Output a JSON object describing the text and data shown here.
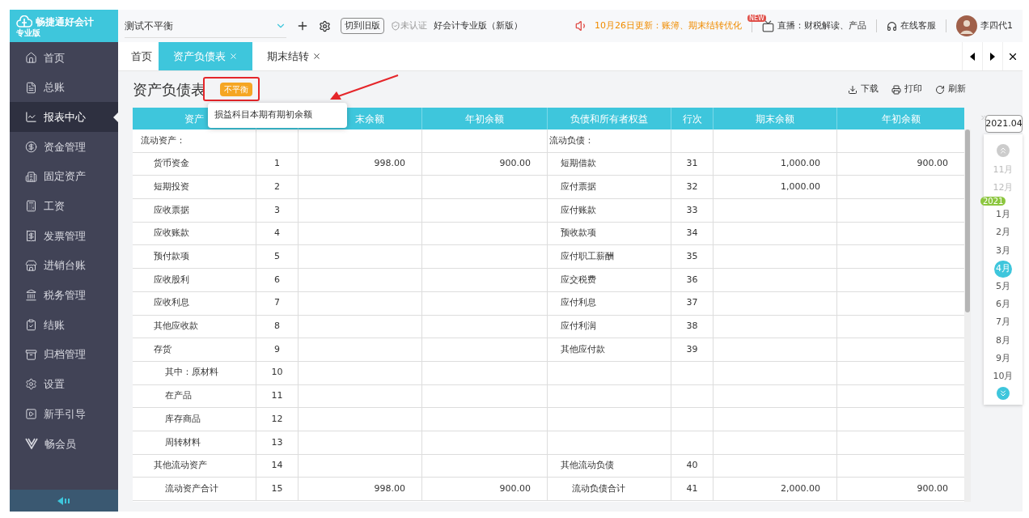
{
  "sidebar": {
    "logo": {
      "name": "畅捷通好会计",
      "edition": "专业版"
    },
    "items": [
      {
        "label": "首页",
        "selected": false
      },
      {
        "label": "总账",
        "selected": false
      },
      {
        "label": "报表中心",
        "selected": true
      },
      {
        "label": "资金管理",
        "selected": false
      },
      {
        "label": "固定资产",
        "selected": false
      },
      {
        "label": "工资",
        "selected": false
      },
      {
        "label": "发票管理",
        "selected": false
      },
      {
        "label": "进销台账",
        "selected": false
      },
      {
        "label": "税务管理",
        "selected": false
      },
      {
        "label": "结账",
        "selected": false
      },
      {
        "label": "归档管理",
        "selected": false
      },
      {
        "label": "设置",
        "selected": false
      },
      {
        "label": "新手引导",
        "selected": false
      },
      {
        "label": "畅会员",
        "selected": false
      }
    ]
  },
  "top_bar": {
    "account": "测试不平衡",
    "old_version_button": "切到旧版",
    "verify_status": "未认证",
    "product": "好会计专业版（新版）",
    "announcement": "10月26日更新：账簿、期末结转优化",
    "live_badge": "NEW",
    "live": "直播：财税解读、产品",
    "service": "在线客服",
    "user": "李四代1"
  },
  "tabs": [
    {
      "label": "首页",
      "closable": false,
      "selected": false
    },
    {
      "label": "资产负债表",
      "closable": true,
      "selected": true
    },
    {
      "label": "期末结转",
      "closable": true,
      "selected": false
    }
  ],
  "report": {
    "title": "资产负债表",
    "status": "不平衡",
    "tooltip": "损益科目本期有期初余额",
    "actions": [
      "下载",
      "打印",
      "刷新"
    ],
    "columns": [
      {
        "label": "资产"
      },
      {},
      {
        "label": "末余额"
      },
      {
        "label": "年初余额"
      },
      {
        "label": "负债和所有者权益"
      },
      {
        "label": "行次"
      },
      {
        "label": "期末余额"
      },
      {
        "label": "年初余额"
      }
    ],
    "rows": [
      {
        "kind": "section",
        "left": {
          "name": "流动资产："
        },
        "right": {
          "name": "流动负债："
        }
      },
      {
        "kind": "item",
        "left": {
          "name": "货币资金",
          "line": "1",
          "end": "998.00",
          "begin": "900.00"
        },
        "right": {
          "name": "短期借款",
          "line": "31",
          "end": "1,000.00",
          "begin": "900.00"
        }
      },
      {
        "kind": "item",
        "left": {
          "name": "短期投资",
          "line": "2"
        },
        "right": {
          "name": "应付票据",
          "line": "32",
          "end": "1,000.00"
        }
      },
      {
        "kind": "item",
        "left": {
          "name": "应收票据",
          "line": "3"
        },
        "right": {
          "name": "应付账款",
          "line": "33"
        }
      },
      {
        "kind": "item",
        "left": {
          "name": "应收账款",
          "line": "4"
        },
        "right": {
          "name": "预收款项",
          "line": "34"
        }
      },
      {
        "kind": "item",
        "left": {
          "name": "预付款项",
          "line": "5"
        },
        "right": {
          "name": "应付职工薪酬",
          "line": "35"
        }
      },
      {
        "kind": "item",
        "left": {
          "name": "应收股利",
          "line": "6"
        },
        "right": {
          "name": "应交税费",
          "line": "36"
        }
      },
      {
        "kind": "item",
        "left": {
          "name": "应收利息",
          "line": "7"
        },
        "right": {
          "name": "应付利息",
          "line": "37"
        }
      },
      {
        "kind": "item",
        "left": {
          "name": "其他应收款",
          "line": "8"
        },
        "right": {
          "name": "应付利润",
          "line": "38"
        }
      },
      {
        "kind": "item",
        "left": {
          "name": "存货",
          "line": "9"
        },
        "right": {
          "name": "其他应付款",
          "line": "39"
        }
      },
      {
        "kind": "subitem",
        "left": {
          "name": "其中：原材料",
          "line": "10"
        },
        "right": {}
      },
      {
        "kind": "subitem",
        "left": {
          "name": "在产品",
          "line": "11"
        },
        "right": {}
      },
      {
        "kind": "subitem",
        "left": {
          "name": "库存商品",
          "line": "12"
        },
        "right": {}
      },
      {
        "kind": "subitem",
        "left": {
          "name": "周转材料",
          "line": "13"
        },
        "right": {}
      },
      {
        "kind": "item",
        "left": {
          "name": "其他流动资产",
          "line": "14"
        },
        "right": {
          "name": "其他流动负债",
          "line": "40"
        }
      },
      {
        "kind": "total",
        "left": {
          "name": "流动资产合计",
          "line": "15",
          "end": "998.00",
          "begin": "900.00"
        },
        "right": {
          "name": "流动负债合计",
          "line": "41",
          "end": "2,000.00",
          "begin": "900.00"
        }
      }
    ]
  },
  "period": {
    "value": "2021.04",
    "months": [
      {
        "kind": "month",
        "label": "11月",
        "selected": false,
        "disabled": true
      },
      {
        "kind": "month",
        "label": "12月",
        "selected": false,
        "disabled": true
      },
      {
        "kind": "year",
        "label": "2021"
      },
      {
        "kind": "month",
        "label": "1月",
        "selected": false,
        "disabled": false
      },
      {
        "kind": "month",
        "label": "2月",
        "selected": false,
        "disabled": false
      },
      {
        "kind": "month",
        "label": "3月",
        "selected": false,
        "disabled": false
      },
      {
        "kind": "month",
        "label": "4月",
        "selected": true,
        "disabled": false
      },
      {
        "kind": "month",
        "label": "5月",
        "selected": false,
        "disabled": false
      },
      {
        "kind": "month",
        "label": "6月",
        "selected": false,
        "disabled": false
      },
      {
        "kind": "month",
        "label": "7月",
        "selected": false,
        "disabled": false
      },
      {
        "kind": "month",
        "label": "8月",
        "selected": false,
        "disabled": false
      },
      {
        "kind": "month",
        "label": "9月",
        "selected": false,
        "disabled": false
      },
      {
        "kind": "month",
        "label": "10月",
        "selected": false,
        "disabled": false
      }
    ]
  }
}
